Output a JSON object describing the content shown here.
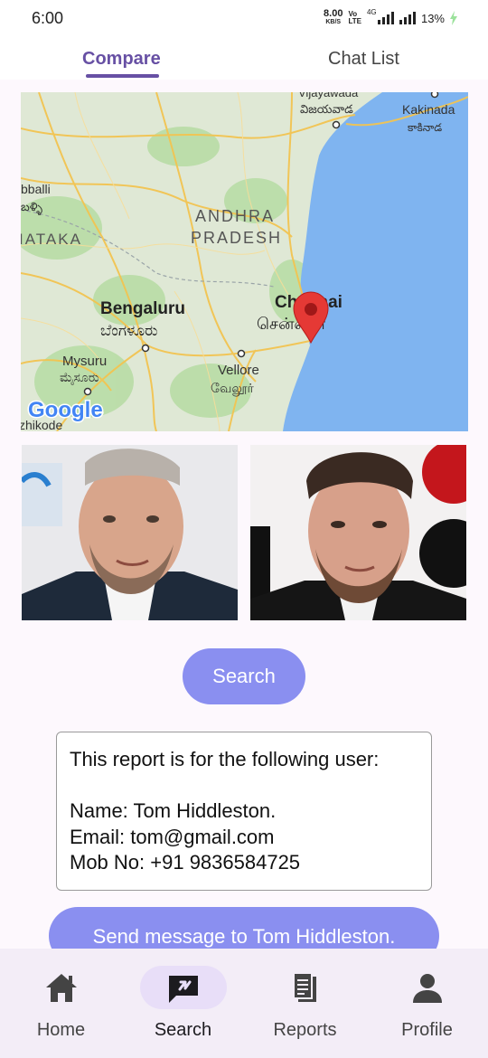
{
  "status_bar": {
    "time": "6:00",
    "net_speed_value": "8.00",
    "net_speed_unit": "KB/S",
    "volte_top": "Vo",
    "volte_bottom": "LTE",
    "network_type": "4G",
    "battery": "13%"
  },
  "tabs": [
    {
      "label": "Compare",
      "active": true
    },
    {
      "label": "Chat List",
      "active": false
    }
  ],
  "map": {
    "places": [
      {
        "name": "Vijayawada"
      },
      {
        "name": "విజయవాడ"
      },
      {
        "name": "Kakinada"
      },
      {
        "name": "కాకినాడ"
      },
      {
        "name": "bballi"
      },
      {
        "name": "బళ్ళి"
      },
      {
        "name": "ANDHRA"
      },
      {
        "name": "PRADESH"
      },
      {
        "name": "IATAKA"
      },
      {
        "name": "Bengaluru"
      },
      {
        "name": "ಬೆಂಗಳೂರು"
      },
      {
        "name": "Chennai"
      },
      {
        "name": "சென்னை"
      },
      {
        "name": "Mysuru"
      },
      {
        "name": "ಮೈಸೂರು"
      },
      {
        "name": "Vellore"
      },
      {
        "name": "வேலூர்"
      },
      {
        "name": "zhikode"
      }
    ],
    "logo": "Google",
    "marker_icon": "map-pin-icon",
    "colors": {
      "land": "#dfe8d5",
      "water": "#7fb4f0",
      "roads": "#f2c451",
      "forest": "#b6dca3"
    }
  },
  "search_button": {
    "label": "Search"
  },
  "report": {
    "intro": "This report is for the following user:",
    "name_line": "Name: Tom Hiddleston.",
    "email_line": "Email: tom@gmail.com",
    "mobile_line": "Mob No: +91 9836584725"
  },
  "send_button": {
    "label": "Send message to Tom Hiddleston."
  },
  "bottom_nav": [
    {
      "label": "Home",
      "icon": "home-icon",
      "active": false
    },
    {
      "label": "Search",
      "icon": "chat-search-icon",
      "active": true
    },
    {
      "label": "Reports",
      "icon": "reports-icon",
      "active": false
    },
    {
      "label": "Profile",
      "icon": "person-icon",
      "active": false
    }
  ],
  "colors": {
    "accent": "#6750a4",
    "button": "#8a8ff0",
    "nav_bg": "#f3edf7",
    "nav_active": "#e8def8"
  }
}
